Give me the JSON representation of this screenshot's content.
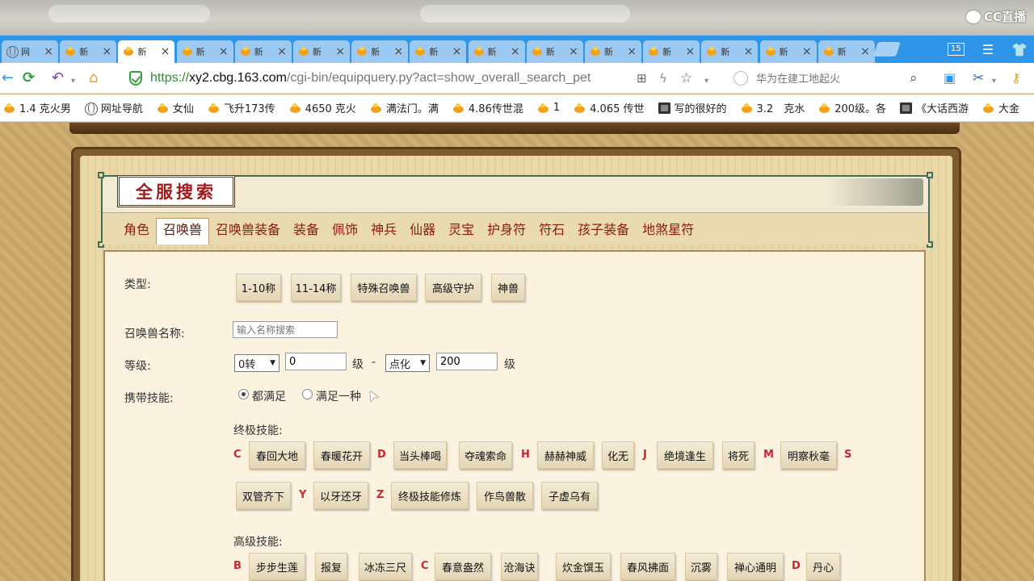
{
  "overlay": {
    "logo": "CC直播"
  },
  "tabs": [
    {
      "title": "网",
      "icon": "globe-icon"
    },
    {
      "title": "新"
    },
    {
      "title": "新",
      "active": true
    },
    {
      "title": "新"
    },
    {
      "title": "新"
    },
    {
      "title": "新"
    },
    {
      "title": "新"
    },
    {
      "title": "新"
    },
    {
      "title": "新"
    },
    {
      "title": "新"
    },
    {
      "title": "新"
    },
    {
      "title": "新"
    },
    {
      "title": "新"
    },
    {
      "title": "新"
    },
    {
      "title": "新"
    }
  ],
  "window": {
    "tab_count": "15"
  },
  "address": {
    "proto": "https://",
    "host": "xy2.cbg.163.com",
    "path": "/cgi-bin/equipquery.py?act=show_overall_search_pet",
    "search_placeholder": "华为在建工地起火"
  },
  "bookmarks": [
    {
      "label": "1.4 克火男"
    },
    {
      "label": "网址导航",
      "icon": "globe"
    },
    {
      "label": "女仙"
    },
    {
      "label": "飞升173传"
    },
    {
      "label": "4650 克火"
    },
    {
      "label": "满法门。满"
    },
    {
      "label": "4.86传世混"
    },
    {
      "label": "1"
    },
    {
      "label": "4.065 传世"
    },
    {
      "label": "写的很好的",
      "icon": "photo"
    },
    {
      "label": "3.2　克水"
    },
    {
      "label": "200级。各"
    },
    {
      "label": "《大话西游",
      "icon": "photo"
    },
    {
      "label": "大金"
    }
  ],
  "page": {
    "title": "全服搜索",
    "categories": [
      "角色",
      "召唤兽",
      "召唤兽装备",
      "装备",
      "佩饰",
      "神兵",
      "仙器",
      "灵宝",
      "护身符",
      "符石",
      "孩子装备",
      "地煞星符"
    ],
    "active_category": "召唤兽"
  },
  "form": {
    "type_label": "类型:",
    "types": [
      "1-10称",
      "11-14称",
      "特殊召唤兽",
      "高级守护",
      "神兽"
    ],
    "name_label": "召唤兽名称:",
    "name_placeholder": "输入名称搜索",
    "level_label": "等级:",
    "level_min_select": "0转",
    "level_min_value": "0",
    "level_unit": "级",
    "dash": "-",
    "level_max_select": "点化",
    "level_max_value": "200",
    "skills_label": "携带技能:",
    "radio_all": "都满足",
    "radio_any": "满足一种",
    "ultimate_label": "终极技能:",
    "ultimate_row1": [
      {
        "letter": "C"
      },
      {
        "btn": "春回大地"
      },
      {
        "btn": "春暖花开"
      },
      {
        "letter": "D"
      },
      {
        "btn": "当头棒喝"
      },
      {
        "btn": "夺魂索命"
      },
      {
        "letter": "H"
      },
      {
        "btn": "赫赫神威"
      },
      {
        "btn": "化无"
      },
      {
        "letter": "J"
      },
      {
        "btn": "绝境逢生"
      },
      {
        "btn": "将死"
      },
      {
        "letter": "M"
      },
      {
        "btn": "明察秋毫"
      },
      {
        "letter": "S"
      }
    ],
    "ultimate_row2": [
      {
        "btn": "双管齐下"
      },
      {
        "letter": "Y"
      },
      {
        "btn": "以牙还牙"
      },
      {
        "letter": "Z"
      },
      {
        "btn": "终极技能修炼"
      },
      {
        "btn": "作鸟兽散"
      },
      {
        "btn": "子虚乌有"
      }
    ],
    "advanced_label": "高级技能:",
    "advanced_row1": [
      {
        "letter": "B"
      },
      {
        "btn": "步步生莲"
      },
      {
        "btn": "报复"
      },
      {
        "btn": "冰冻三尺"
      },
      {
        "letter": "C"
      },
      {
        "btn": "春意盎然"
      },
      {
        "btn": "沧海诀"
      },
      {
        "btn": "炊金馔玉"
      },
      {
        "btn": "春风拂面"
      },
      {
        "btn": "沉雾"
      },
      {
        "btn": "禅心通明"
      },
      {
        "letter": "D"
      },
      {
        "btn": "丹心"
      }
    ]
  }
}
